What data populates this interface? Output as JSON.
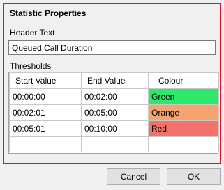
{
  "panel": {
    "title": "Statistic Properties",
    "header_text_label": "Header Text",
    "header_text_value": "Queued Call Duration",
    "thresholds_label": "Thresholds"
  },
  "thresholds": {
    "columns": [
      "Start Value",
      "End Value",
      "Colour"
    ],
    "rows": [
      {
        "start": "00:00:00",
        "end": "00:02:00",
        "colour": "Green",
        "colour_hex": "#2ee86a"
      },
      {
        "start": "00:02:01",
        "end": "00:05:00",
        "colour": "Orange",
        "colour_hex": "#f5a46f"
      },
      {
        "start": "00:05:01",
        "end": "00:10:00",
        "colour": "Red",
        "colour_hex": "#f2726c"
      }
    ]
  },
  "buttons": {
    "cancel": "Cancel",
    "ok": "OK"
  },
  "accent": {
    "panel_border": "#e81123"
  }
}
